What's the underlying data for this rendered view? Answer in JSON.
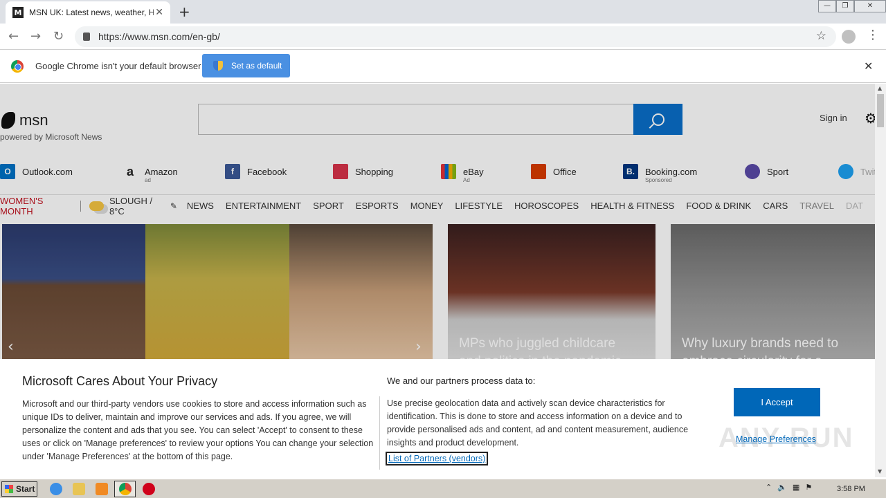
{
  "browser": {
    "tab_title": "MSN UK: Latest news, weather, Hot",
    "tab_favicon": "M",
    "url": "https://www.msn.com/en-gb/"
  },
  "infobar": {
    "message": "Google Chrome isn't your default browser",
    "button_label": "Set as default"
  },
  "msn": {
    "logo_text": "msn",
    "powered_by": "powered by Microsoft News",
    "sign_in": "Sign in"
  },
  "quicklinks": [
    {
      "label": "Outlook.com",
      "sub": "",
      "icon": "outlook-icon",
      "color": "#0072c6",
      "glyph": "O"
    },
    {
      "label": "Amazon",
      "sub": "ad",
      "icon": "amazon-icon",
      "color": "#222222",
      "glyph": "a"
    },
    {
      "label": "Facebook",
      "sub": "",
      "icon": "facebook-icon",
      "color": "#3b5998",
      "glyph": "f"
    },
    {
      "label": "Shopping",
      "sub": "",
      "icon": "shopping-bag-icon",
      "color": "#d8334a",
      "glyph": ""
    },
    {
      "label": "eBay",
      "sub": "Ad",
      "icon": "ebay-icon",
      "color": "#333333",
      "glyph": ""
    },
    {
      "label": "Office",
      "sub": "",
      "icon": "office-icon",
      "color": "#d83b01",
      "glyph": ""
    },
    {
      "label": "Booking.com",
      "sub": "Sponsored",
      "icon": "booking-icon",
      "color": "#003580",
      "glyph": "B."
    },
    {
      "label": "Sport",
      "sub": "",
      "icon": "sport-icon",
      "color": "#5a4aa8",
      "glyph": ""
    },
    {
      "label": "Twit",
      "sub": "",
      "icon": "twitter-icon",
      "color": "#1da1f2",
      "glyph": ""
    }
  ],
  "nav": {
    "womens_month": "WOMEN'S MONTH",
    "weather": "SLOUGH / 8°C",
    "categories": [
      "NEWS",
      "ENTERTAINMENT",
      "SPORT",
      "ESPORTS",
      "MONEY",
      "LIFESTYLE",
      "HOROSCOPES",
      "HEALTH & FITNESS",
      "FOOD & DRINK",
      "CARS",
      "TRAVEL",
      "DAT"
    ]
  },
  "stories": [
    {
      "caption": "MPs who juggled childcare and politics in the pandemic"
    },
    {
      "caption": "Why luxury brands need to embrace circularity for a"
    }
  ],
  "privacy": {
    "title": "Microsoft Cares About Your Privacy",
    "left_text": "Microsoft and our third-party vendors use cookies to store and access information such as unique IDs to deliver, maintain and improve our services and ads. If you agree, we will personalize the content and ads that you see. You can select 'Accept' to consent to these uses or click on 'Manage preferences' to review your options You can change your selection under 'Manage Preferences' at the bottom of this page.",
    "right_heading": "We and our partners process data to:",
    "right_text": "Use precise geolocation data and actively scan device characteristics for identification. This is done to store and access information on a device and to provide personalised ads and content, ad and content measurement, audience insights and product development.",
    "partners_link": "List of Partners (vendors)",
    "accept_label": "I Accept",
    "manage_label": "Manage Preferences"
  },
  "watermark": "ANY RUN",
  "taskbar": {
    "start_label": "Start",
    "clock": "3:58 PM"
  }
}
